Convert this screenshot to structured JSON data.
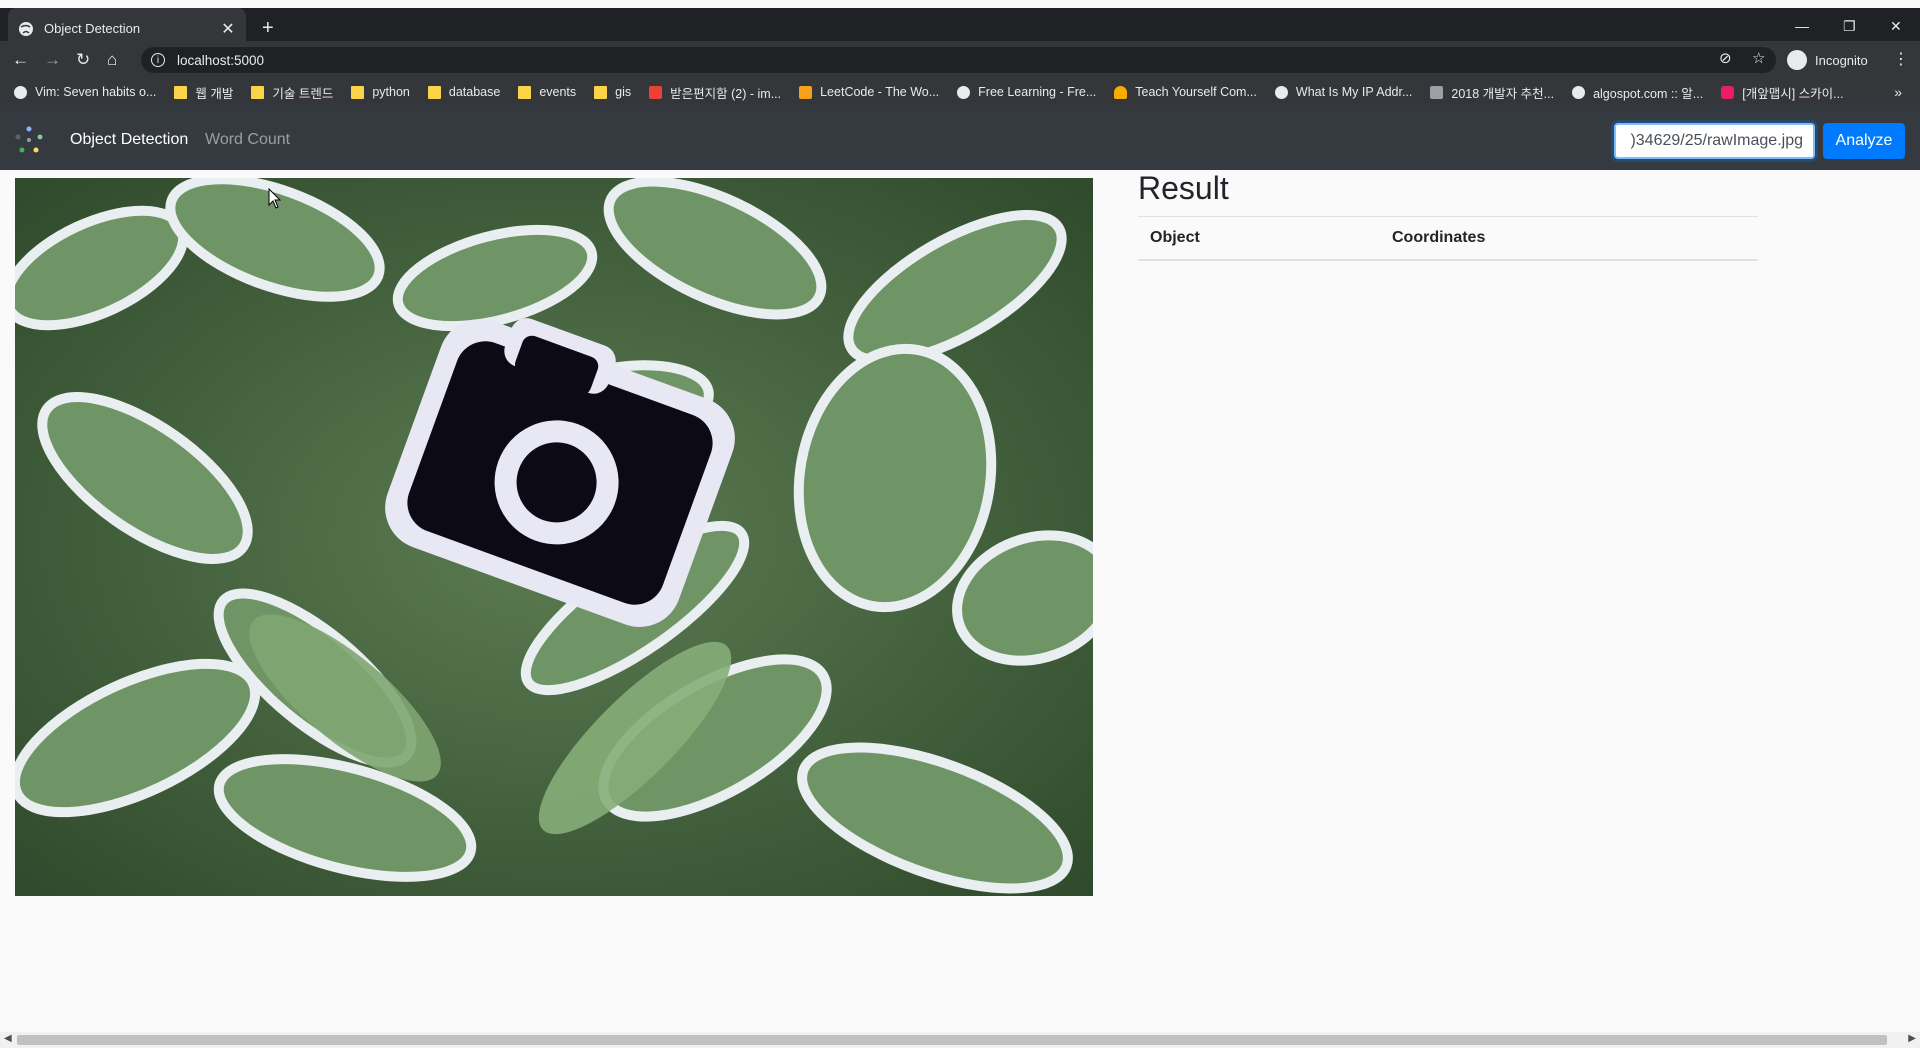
{
  "browser": {
    "tab_title": "Object Detection",
    "tab_close": "✕",
    "new_tab": "+",
    "address": "localhost:5000",
    "profile_label": "Incognito",
    "window_controls": {
      "minimize": "—",
      "restore": "❐",
      "close": "✕"
    },
    "bookmarks": [
      {
        "label": "Vim: Seven habits o...",
        "icon": "globe-icon"
      },
      {
        "label": "웹 개발",
        "icon": "folder-icon"
      },
      {
        "label": "기술 트렌드",
        "icon": "folder-icon"
      },
      {
        "label": "python",
        "icon": "folder-icon"
      },
      {
        "label": "database",
        "icon": "folder-icon"
      },
      {
        "label": "events",
        "icon": "folder-icon"
      },
      {
        "label": "gis",
        "icon": "folder-icon"
      },
      {
        "label": "받은편지함 (2) - im...",
        "icon": "gmail-icon"
      },
      {
        "label": "LeetCode - The Wo...",
        "icon": "leetcode-icon"
      },
      {
        "label": "Free Learning - Fre...",
        "icon": "globe-icon"
      },
      {
        "label": "Teach Yourself Com...",
        "icon": "key-icon"
      },
      {
        "label": "What Is My IP Addr...",
        "icon": "globe-icon"
      },
      {
        "label": "2018 개발자 추천...",
        "icon": "slash-icon"
      },
      {
        "label": "algospot.com :: 알...",
        "icon": "globe-icon"
      },
      {
        "label": "[개앞맵시] 스카이...",
        "icon": "pink-icon"
      }
    ],
    "bookmarks_more": "»"
  },
  "navbar": {
    "brand": "Object Detection",
    "link_word_count": "Word Count",
    "url_input_value": ")34629/25/rawImage.jpg",
    "analyze_label": "Analyze"
  },
  "result": {
    "title": "Result",
    "columns": [
      "Object",
      "Coordinates"
    ]
  },
  "colors": {
    "navbar_bg": "#343a40",
    "primary": "#007bff",
    "chrome_dark": "#202124",
    "chrome_mid": "#35363a"
  }
}
